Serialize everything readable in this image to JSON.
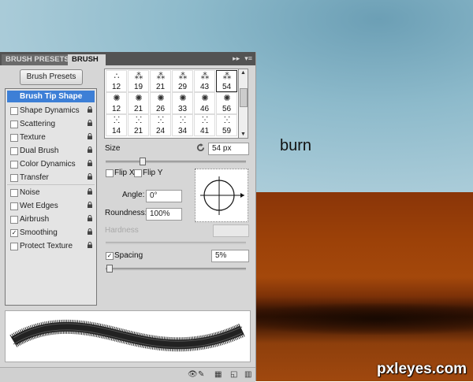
{
  "background": {
    "caption": "burn",
    "watermark": "pxleyes.com"
  },
  "panel": {
    "tabs": [
      {
        "label": "BRUSH PRESETS"
      },
      {
        "label": "BRUSH"
      }
    ],
    "presets_button": "Brush Presets",
    "options": [
      {
        "label": "Brush Tip Shape",
        "selected": true,
        "checkbox": false,
        "lock": false
      },
      {
        "label": "Shape Dynamics",
        "checked": false,
        "lock": true
      },
      {
        "label": "Scattering",
        "checked": false,
        "lock": true
      },
      {
        "label": "Texture",
        "checked": false,
        "lock": true
      },
      {
        "label": "Dual Brush",
        "checked": false,
        "lock": true
      },
      {
        "label": "Color Dynamics",
        "checked": false,
        "lock": true
      },
      {
        "label": "Transfer",
        "checked": false,
        "lock": true
      },
      {
        "label": "Noise",
        "checked": false,
        "lock": true
      },
      {
        "label": "Wet Edges",
        "checked": false,
        "lock": true
      },
      {
        "label": "Airbrush",
        "checked": false,
        "lock": true
      },
      {
        "label": "Smoothing",
        "checked": true,
        "lock": true
      },
      {
        "label": "Protect Texture",
        "checked": false,
        "lock": true
      }
    ],
    "tips": [
      [
        "12",
        "19",
        "21",
        "29",
        "43",
        "54"
      ],
      [
        "12",
        "21",
        "26",
        "33",
        "46",
        "56"
      ],
      [
        "14",
        "21",
        "24",
        "34",
        "41",
        "59"
      ]
    ],
    "size_label": "Size",
    "size_value": "54 px",
    "flip_x": "Flip X",
    "flip_y": "Flip Y",
    "angle_label": "Angle:",
    "angle_value": "0°",
    "roundness_label": "Roundness:",
    "roundness_value": "100%",
    "hardness_label": "Hardness",
    "spacing_label": "Spacing",
    "spacing_value": "5%",
    "spacing_checked": true
  },
  "colors": {
    "selection": "#3d7fd6",
    "panel": "#d6d6d6",
    "tabbar": "#535353"
  }
}
